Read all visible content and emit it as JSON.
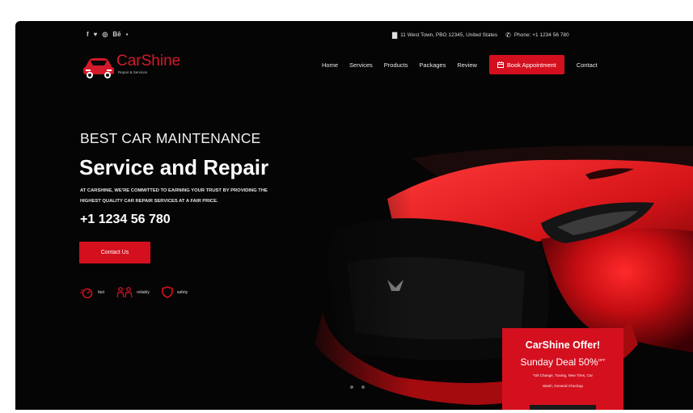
{
  "topbar": {
    "social_icons": [
      {
        "name": "facebook-icon",
        "glyph": "f"
      },
      {
        "name": "twitter-icon",
        "glyph": "♥"
      },
      {
        "name": "instagram-icon",
        "glyph": "◎"
      },
      {
        "name": "behance-icon",
        "glyph": "Bē"
      },
      {
        "name": "youtube-icon",
        "glyph": "▪"
      }
    ],
    "address": "11 West Town, PBO 12345, United States",
    "phone": "Phone: +1 1234 56 780"
  },
  "brand": {
    "name": "CarShine",
    "tagline": "Repair & Services",
    "color": "#d31a2a"
  },
  "nav": {
    "items": [
      "Home",
      "Services",
      "Products",
      "Packages",
      "Review"
    ],
    "book_label": "Book Appointment",
    "contact_label": "Contact"
  },
  "hero": {
    "eyebrow": "BEST CAR MAINTENANCE",
    "title": "Service and Repair",
    "description_line1": "AT CARSHINE, WE'RE COMMITTED TO EARNING YOUR TRUST BY PROVIDING THE",
    "description_line2": "HIGHEST QUALITY CAR REPAIR SERVICES AT A FAIR PRICE.",
    "phone": "+1 1234 56 780",
    "cta_label": "Contact Us",
    "features": [
      "fast",
      "reliably",
      "safety"
    ]
  },
  "offer": {
    "title": "CarShine Offer!",
    "deal": "Sunday Deal 50%",
    "deal_sup": "OFF",
    "details_line1": "*Oil Change, Tuning, New Tires, Car",
    "details_line2": "Wash, General Checkup"
  },
  "colors": {
    "accent": "#d4101f",
    "background": "#050505"
  }
}
